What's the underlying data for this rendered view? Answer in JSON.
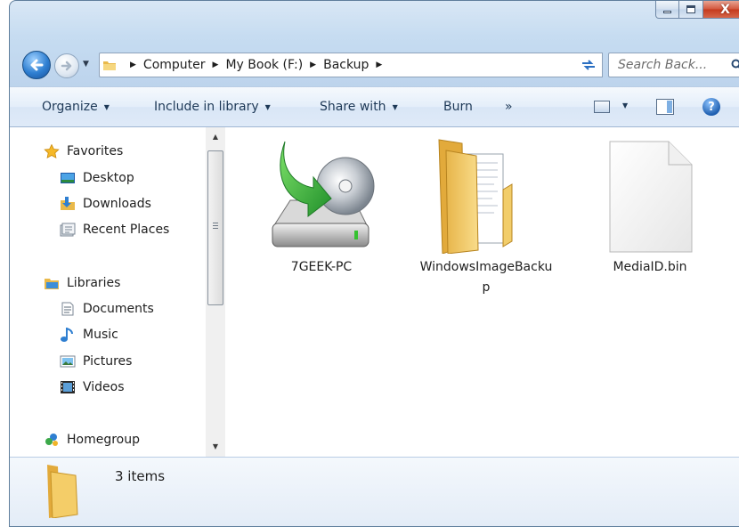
{
  "window": {
    "controls": {
      "minimize": "minimize",
      "maximize": "maximize",
      "close": "X"
    }
  },
  "address": {
    "crumbs": [
      "Computer",
      "My Book (F:)",
      "Backup"
    ],
    "search_placeholder": "Search Back..."
  },
  "toolbar": {
    "organize": "Organize",
    "include_in_library": "Include in library",
    "share_with": "Share with",
    "burn": "Burn",
    "more": "»",
    "help": "?"
  },
  "nav": {
    "favorites": "Favorites",
    "favorites_items": [
      "Desktop",
      "Downloads",
      "Recent Places"
    ],
    "libraries": "Libraries",
    "libraries_items": [
      "Documents",
      "Music",
      "Pictures",
      "Videos"
    ],
    "homegroup": "Homegroup"
  },
  "files": [
    {
      "label": "7GEEK-PC",
      "icon": "backup-drive-icon"
    },
    {
      "label": "WindowsImageBackup",
      "icon": "folder-icon"
    },
    {
      "label": "MediaID.bin",
      "icon": "file-icon"
    }
  ],
  "details": {
    "item_count": "3 items"
  },
  "colors": {
    "accent": "#2f7fd1",
    "frame": "#bcd3ec",
    "folder": "#f2cd6a"
  }
}
